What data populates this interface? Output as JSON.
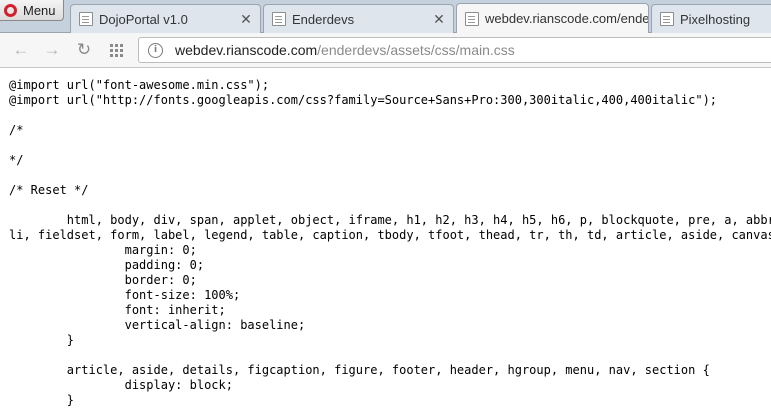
{
  "menu": {
    "label": "Menu"
  },
  "tabs": [
    {
      "title": "DojoPortal v1.0",
      "active": false,
      "closable": true
    },
    {
      "title": "Enderdevs",
      "active": false,
      "closable": true
    },
    {
      "title": "webdev.rianscode.com/enderdevs/assets/css/main.css",
      "active": true,
      "closable": false
    },
    {
      "title": "Pixelhosting",
      "active": false,
      "closable": false
    }
  ],
  "toolbar": {
    "back_icon": "back-arrow-icon",
    "forward_icon": "forward-arrow-icon",
    "reload_icon": "reload-icon",
    "speed_dial_icon": "speed-dial-icon"
  },
  "address": {
    "host": "webdev.rianscode.com",
    "path": "/enderdevs/assets/css/main.css"
  },
  "source_lines": [
    "@import url(\"font-awesome.min.css\");",
    "@import url(\"http://fonts.googleapis.com/css?family=Source+Sans+Pro:300,300italic,400,400italic\");",
    "",
    "/*",
    "",
    "*/",
    "",
    "/* Reset */",
    "",
    "\thtml, body, div, span, applet, object, iframe, h1, h2, h3, h4, h5, h6, p, blockquote, pre, a, abbr,",
    "li, fieldset, form, label, legend, table, caption, tbody, tfoot, thead, tr, th, td, article, aside, canvas,",
    "\t\tmargin: 0;",
    "\t\tpadding: 0;",
    "\t\tborder: 0;",
    "\t\tfont-size: 100%;",
    "\t\tfont: inherit;",
    "\t\tvertical-align: baseline;",
    "\t}",
    "",
    "\tarticle, aside, details, figcaption, figure, footer, header, hgroup, menu, nav, section {",
    "\t\tdisplay: block;",
    "\t}"
  ]
}
